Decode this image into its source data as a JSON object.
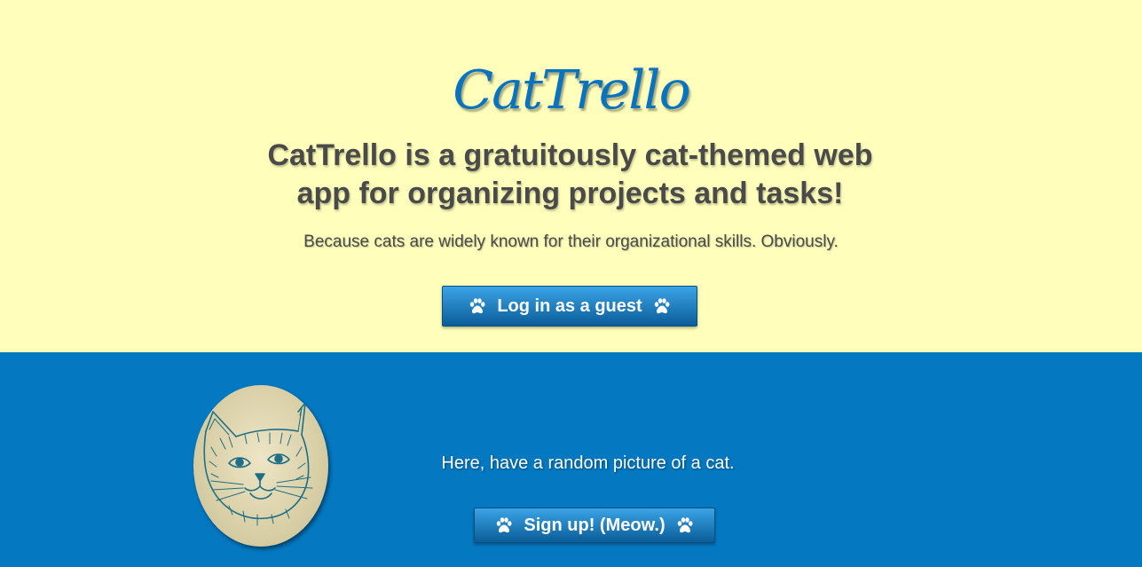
{
  "hero": {
    "logo": "CatTrello",
    "headline": "CatTrello is a gratuitously cat-themed web app for organizing projects and tasks!",
    "subline": "Because cats are widely known for their organizational skills. Obviously.",
    "guest_button_label": "Log in as a guest"
  },
  "footer": {
    "cat_caption": "Here, have a random picture of a cat.",
    "signup_button_label": "Sign up! (Meow.)"
  },
  "colors": {
    "hero_background": "#ffffbb",
    "footer_background": "#0478c0",
    "logo_blue": "#0a73bd",
    "headline_text": "#4a4a4a",
    "button_gradient_top": "#3ba4e6",
    "button_gradient_bottom": "#0a5d98"
  },
  "icons": {
    "button_icon": "paw-icon",
    "cat_image": "cat-sketch-image"
  }
}
